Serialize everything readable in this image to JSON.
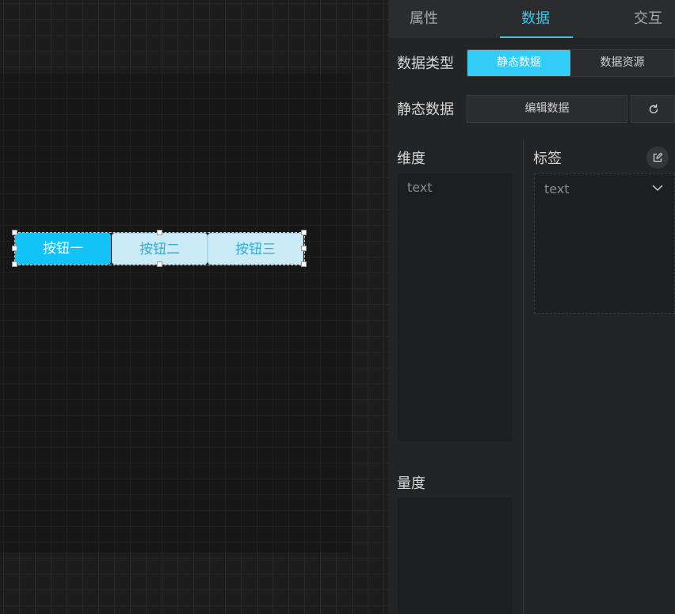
{
  "canvas": {
    "buttons": [
      {
        "label": "按钮一",
        "active": true
      },
      {
        "label": "按钮二",
        "active": false
      },
      {
        "label": "按钮三",
        "active": false
      }
    ]
  },
  "panel": {
    "tabs": [
      {
        "label": "属性"
      },
      {
        "label": "数据",
        "active": true
      },
      {
        "label": "交互"
      }
    ],
    "data_type": {
      "label": "数据类型",
      "options": [
        "静态数据",
        "数据资源"
      ],
      "selected": "静态数据"
    },
    "static_data": {
      "label": "静态数据",
      "edit_label": "编辑数据"
    },
    "dimension": {
      "label": "维度",
      "items": [
        "text"
      ]
    },
    "measure": {
      "label": "量度"
    },
    "tag": {
      "label": "标签",
      "value": "text"
    }
  },
  "colors": {
    "accent": "#2ec9f5",
    "button_active": "#13c2f7",
    "button_inactive": "#cbebf6"
  }
}
